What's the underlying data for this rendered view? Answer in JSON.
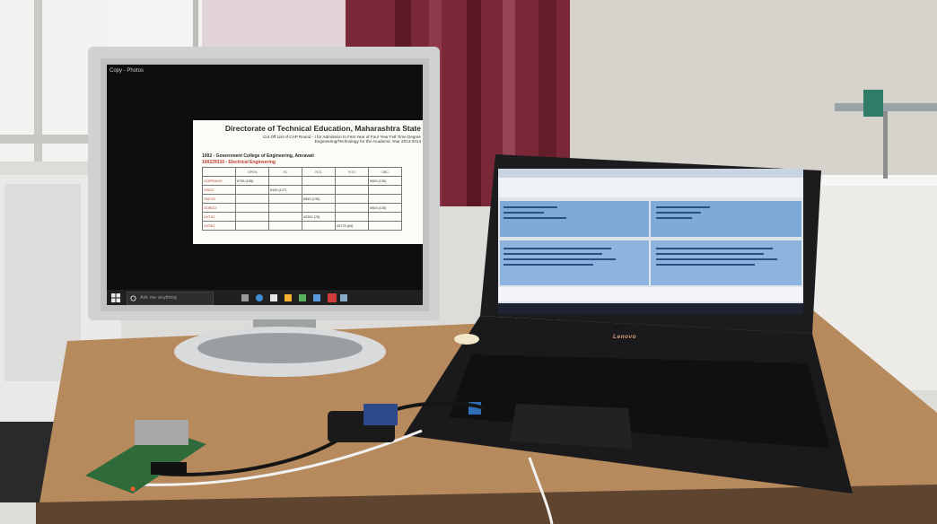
{
  "monitor": {
    "window_title": "Copy - Photos",
    "document": {
      "title": "Directorate of Technical Education, Maharashtra State",
      "subtitle_line1": "Cut Off List of CAP Round - I for Admission to First Year of Four Year Full Time Degree",
      "subtitle_line2": "Engineering/Technology for the Academic Year 2013-2014",
      "college": "1002 - Government College of Engineering, Amravati",
      "branch": "100229310 - Electrical Engineering",
      "table": {
        "headers": [
          "",
          "OPEN",
          "SC",
          "NT1",
          "NT3",
          "OBC"
        ],
        "rows": [
          [
            "GOPENH/O",
            "6795 (156)",
            "",
            "",
            "",
            "6963 (135)"
          ],
          [
            "GSCO",
            "",
            "9449 (127)",
            "",
            "",
            ""
          ],
          [
            "GNT1O",
            "",
            "",
            "6963 (135)",
            "",
            ""
          ],
          [
            "GOBCO",
            "",
            "",
            "",
            "",
            "6963 (135)"
          ],
          [
            "LNT1O",
            "",
            "",
            "42351 (78)",
            "",
            ""
          ],
          [
            "LNT3O",
            "",
            "",
            "",
            "43776 (64)",
            ""
          ]
        ]
      }
    },
    "taskbar": {
      "search_placeholder": "Ask me anything"
    }
  },
  "laptop": {
    "brand": "Lenovo"
  },
  "colors": {
    "wall": "#d9d7d2",
    "desk": "#b98a5c",
    "curtain": "#7a2434",
    "pcb": "#2f6b3a"
  }
}
